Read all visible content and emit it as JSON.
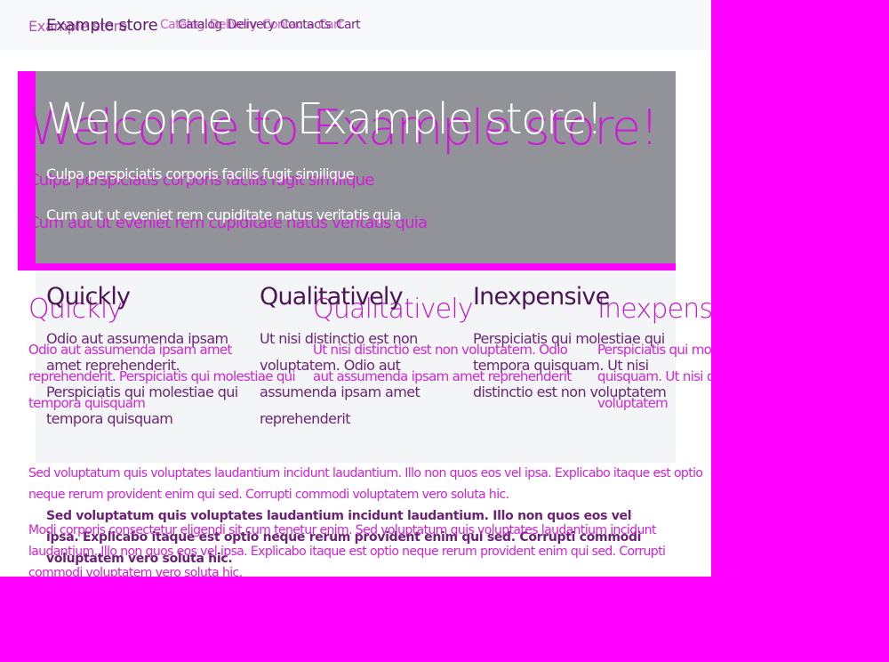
{
  "navbar": {
    "brand": "Example store",
    "links": [
      "Catalog",
      "Delivery",
      "Contacts",
      "Cart"
    ]
  },
  "hero": {
    "title": "Welcome to Example store!",
    "lines": [
      "Culpa perspiciatis corporis facilis fugit similique",
      "Cum aut ut eveniet rem cupiditate natus veritatis quia"
    ]
  },
  "features": [
    {
      "title": "Quickly",
      "text": "Odio aut assumenda ipsam amet reprehenderit. Perspiciatis qui molestiae qui tempora quisquam"
    },
    {
      "title": "Qualitatively",
      "text": "Ut nisi distinctio est non voluptatem. Odio aut assumenda ipsam amet reprehenderit"
    },
    {
      "title": "Inexpensive",
      "text": "Perspiciatis qui molestiae qui tempora quisquam. Ut nisi distinctio est non voluptatem"
    }
  ],
  "paragraphs": [
    "Sed voluptatum quis voluptates laudantium incidunt laudantium. Illo non quos eos vel ipsa. Explicabo itaque est optio neque rerum provident enim qui sed. Corrupti commodi voluptatem vero soluta hic.",
    "Modi corporis consectetur eligendi sit cum tenetur enim. Sed voluptatum quis voluptates laudantium incidunt laudantium. Illo non quos eos vel ipsa. Explicabo itaque est optio neque rerum provident enim qui sed. Corrupti commodi voluptatem vero soluta hic."
  ],
  "colors": {
    "overlay": "#ff00ff",
    "hero_panel": "#919399",
    "feature_bg": "#f4f5f7",
    "navbar_bg": "#f7f8f9"
  }
}
